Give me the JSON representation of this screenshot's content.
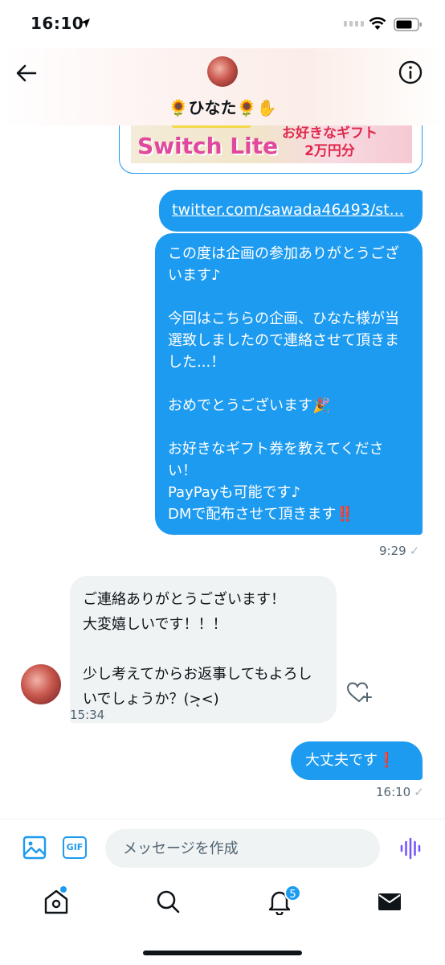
{
  "status_bar": {
    "time": "16:10"
  },
  "header": {
    "name": "🌻ひなた🌻✋"
  },
  "card": {
    "title": "Switch Lite",
    "subtitle_line1": "お好きなギフト",
    "subtitle_line2": "2万円分"
  },
  "messages": [
    {
      "direction": "out",
      "type": "link",
      "text": "twitter.com/sawada46493/st..."
    },
    {
      "direction": "out",
      "text": "この度は企画の参加ありがとうございます♪\n\n今回はこちらの企画、ひなた様が当選致しましたので連絡させて頂きました...！\n\nおめでとうございます🎉\n\nお好きなギフト券を教えてください！\nPayPayも可能です♪\nDMで配布させて頂きます‼️",
      "time": "9:29"
    },
    {
      "direction": "in",
      "text": "ご連絡ありがとうございます！\n大変嬉しいです！！！\n\n少し考えてからお返事してもよろしいでしょうか？(>̨<)",
      "time": "15:34"
    },
    {
      "direction": "out",
      "text": "大丈夫です❗️",
      "time": "16:10"
    }
  ],
  "composer": {
    "placeholder": "メッセージを作成",
    "gif_label": "GIF"
  },
  "tabbar": {
    "notification_count": "5"
  }
}
